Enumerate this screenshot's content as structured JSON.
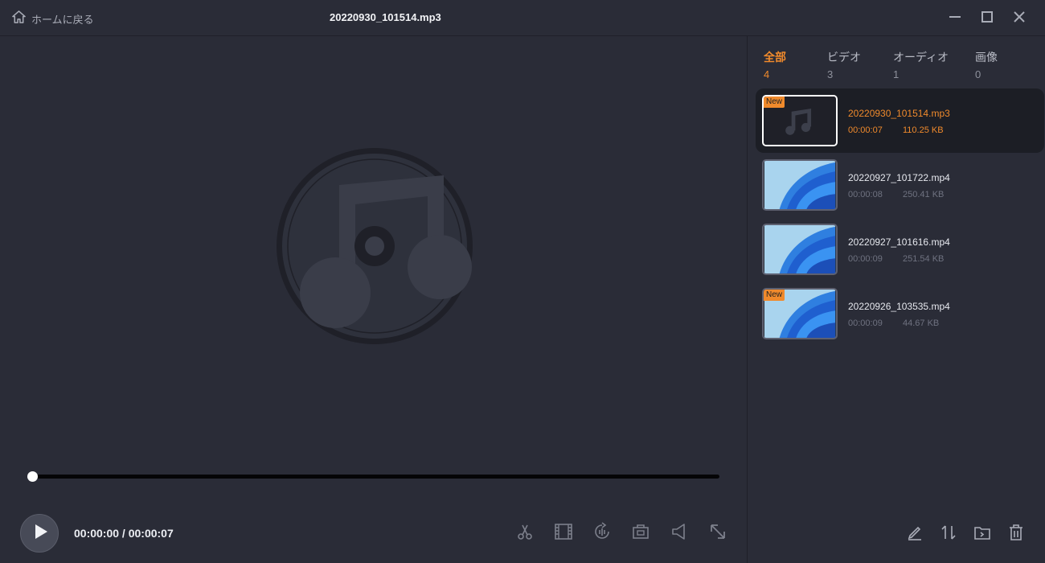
{
  "titlebar": {
    "home_label": "ホームに戻る",
    "file_title": "20220930_101514.mp3"
  },
  "player": {
    "progress_fraction": 0.0,
    "current_time": "00:00:00",
    "total_time": "00:00:07",
    "time_display": "00:00:00 / 00:00:07"
  },
  "tabs": [
    {
      "label": "全部",
      "count": "4",
      "active": true
    },
    {
      "label": "ビデオ",
      "count": "3",
      "active": false
    },
    {
      "label": "オーディオ",
      "count": "1",
      "active": false
    },
    {
      "label": "画像",
      "count": "0",
      "active": false
    }
  ],
  "files": [
    {
      "name": "20220930_101514.mp3",
      "duration": "00:00:07",
      "size": "110.25 KB",
      "badge": "New",
      "kind": "audio",
      "selected": true
    },
    {
      "name": "20220927_101722.mp4",
      "duration": "00:00:08",
      "size": "250.41 KB",
      "badge": "",
      "kind": "video",
      "selected": false
    },
    {
      "name": "20220927_101616.mp4",
      "duration": "00:00:09",
      "size": "251.54 KB",
      "badge": "",
      "kind": "video",
      "selected": false
    },
    {
      "name": "20220926_103535.mp4",
      "duration": "00:00:09",
      "size": "44.67 KB",
      "badge": "New",
      "kind": "video",
      "selected": false
    }
  ],
  "colors": {
    "accent": "#f08a2c",
    "background": "#2a2c37",
    "selected_row": "#1c1e25"
  },
  "icons": {
    "home": "home-icon",
    "minimize": "minimize-icon",
    "maximize": "maximize-icon",
    "close": "close-icon",
    "play": "play-icon",
    "tools": [
      "scissors-icon",
      "film-frames-icon",
      "rotate-icon",
      "camera-icon",
      "speaker-icon",
      "resize-arrow-icon"
    ],
    "actions": [
      "edit-icon",
      "sort-icon",
      "open-folder-icon",
      "trash-icon"
    ]
  }
}
